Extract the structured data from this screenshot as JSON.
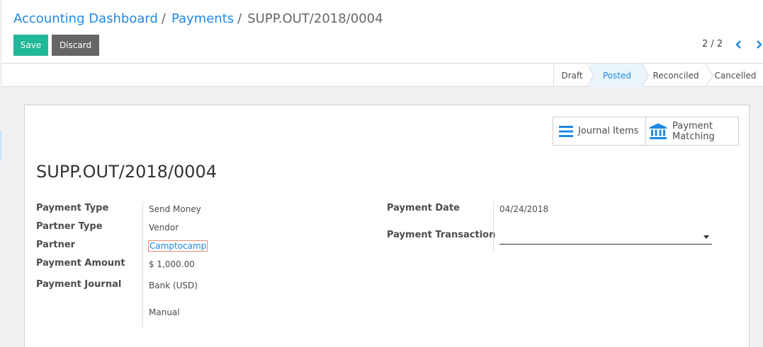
{
  "breadcrumb": [
    {
      "label": "Accounting Dashboard"
    },
    {
      "label": "Payments"
    }
  ],
  "breadcrumb_current": "SUPP.OUT/2018/0004",
  "buttons": {
    "save": "Save",
    "discard": "Discard"
  },
  "pager": {
    "text": "2 / 2"
  },
  "statusbar": {
    "draft": "Draft",
    "posted": "Posted",
    "reconciled": "Reconciled",
    "cancelled": "Cancelled",
    "active": "Posted"
  },
  "smart_buttons": {
    "journal_items": "Journal Items",
    "payment_matching_line1": "Payment",
    "payment_matching_line2": "Matching"
  },
  "record": {
    "title": "SUPP.OUT/2018/0004",
    "payment_type_label": "Payment Type",
    "payment_type": "Send Money",
    "partner_type_label": "Partner Type",
    "partner_type": "Vendor",
    "partner_label": "Partner",
    "partner": "Camptocamp",
    "amount_label": "Payment Amount",
    "amount": "$ 1,000.00",
    "journal_label": "Payment Journal",
    "journal": "Bank (USD)",
    "method": "Manual",
    "date_label": "Payment Date",
    "date": "04/24/2018",
    "transaction_label": "Payment Transaction",
    "transaction": ""
  },
  "colors": {
    "primary": "#1e88e5",
    "save": "#21b799",
    "discard": "#666666"
  },
  "icons": {
    "prev": "chevron-left-icon",
    "next": "chevron-right-icon",
    "journal": "list-icon",
    "matching": "bank-icon",
    "dropdown": "caret-down-icon"
  }
}
